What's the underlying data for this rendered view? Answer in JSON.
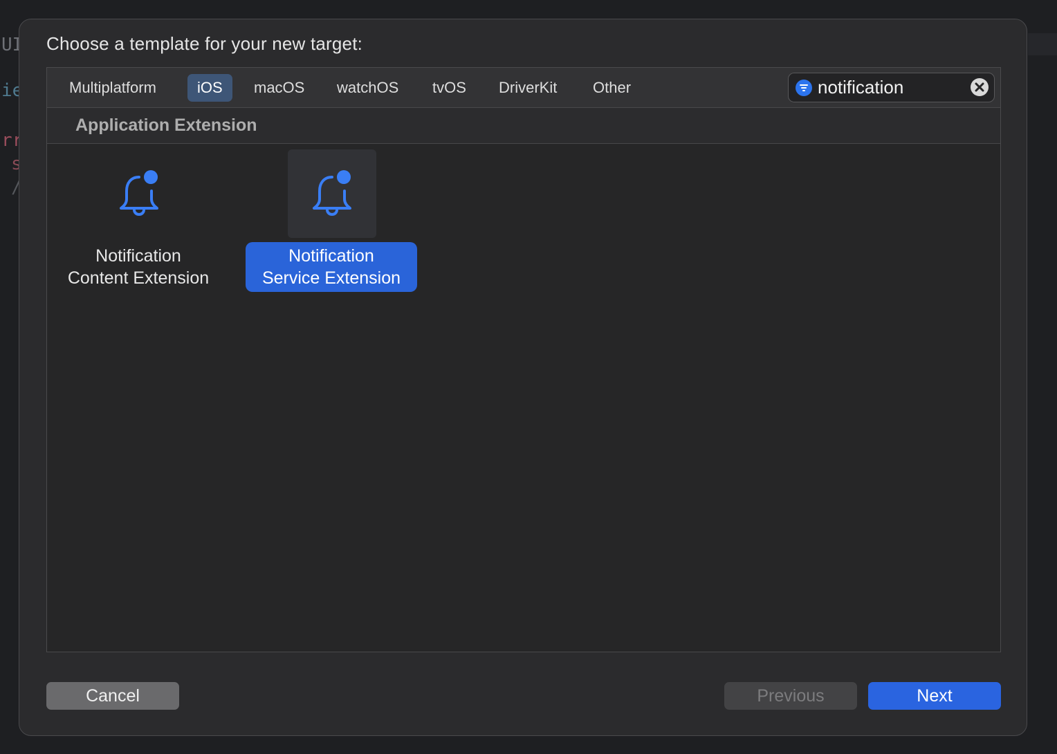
{
  "background": {
    "code_fragments": [
      "UI",
      "ie",
      "rr",
      "s",
      "/"
    ]
  },
  "dialog": {
    "title": "Choose a template for your new target:"
  },
  "platform_tabs": [
    {
      "label": "Multiplatform",
      "selected": false
    },
    {
      "label": "iOS",
      "selected": true
    },
    {
      "label": "macOS",
      "selected": false
    },
    {
      "label": "watchOS",
      "selected": false
    },
    {
      "label": "tvOS",
      "selected": false
    },
    {
      "label": "DriverKit",
      "selected": false
    },
    {
      "label": "Other",
      "selected": false
    }
  ],
  "search": {
    "value": "notification",
    "filter_icon": "filter-icon",
    "clear_icon": "clear-icon"
  },
  "section": {
    "title": "Application Extension"
  },
  "templates": [
    {
      "line1": "Notification",
      "line2": "Content Extension",
      "icon": "bell-badge-icon",
      "selected": false
    },
    {
      "line1": "Notification",
      "line2": "Service Extension",
      "icon": "bell-badge-icon",
      "selected": true
    }
  ],
  "buttons": {
    "cancel": "Cancel",
    "previous": "Previous",
    "next": "Next",
    "previous_enabled": false
  },
  "colors": {
    "accent": "#2a64e0",
    "selected_tab": "#3e5677",
    "icon_blue": "#3a7ef5"
  }
}
